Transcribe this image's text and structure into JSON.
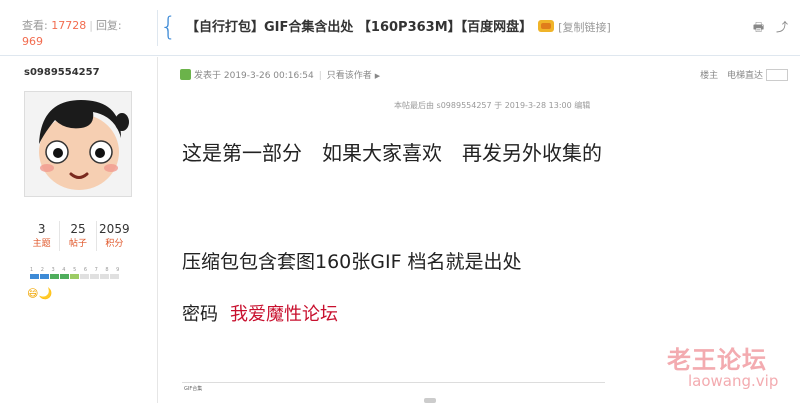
{
  "header": {
    "views_label": "查看:",
    "views": "17728",
    "replies_label": "回复:",
    "replies": "969",
    "separator": "|",
    "title": "【自行打包】GIF合集含出处 【160P363M】【百度网盘】",
    "copy_link": "[复制链接]",
    "print_icon": "🖶",
    "share_icon": "⤴"
  },
  "author": {
    "username": "s0989554257",
    "stats": [
      {
        "value": "3",
        "label": "主题"
      },
      {
        "value": "25",
        "label": "帖子"
      },
      {
        "value": "2059",
        "label": "积分"
      }
    ],
    "level_numbers": "1 2 3 4 5 6 7 8 9",
    "level_fill_colors": [
      "#3d8ad6",
      "#3d8ad6",
      "#4fae5d",
      "#4fae5d",
      "#9ccc65",
      "#e0e0e0",
      "#e0e0e0",
      "#e0e0e0",
      "#e0e0e0"
    ],
    "medals": "😄🌙"
  },
  "post": {
    "posted_at": "发表于 2019-3-26 00:16:54",
    "only_author": "只看该作者",
    "floor": "楼主",
    "direct": "电梯直达",
    "edited": "本帖最后由 s0989554257 于 2019-3-28 13:00 编辑",
    "line1": "这是第一部分　如果大家喜欢　再发另外收集的",
    "line2": "压缩包包含套图160张GIF 档名就是出处",
    "password_label": "密码",
    "password": "我爱魔性论坛",
    "attachment_caption": "GIF合集"
  },
  "watermark": {
    "cn": "老王论坛",
    "url": "laowang.vip"
  },
  "colors": {
    "accent": "#3d8ad6",
    "highlight": "#f26c4f",
    "password": "#c8102e"
  }
}
